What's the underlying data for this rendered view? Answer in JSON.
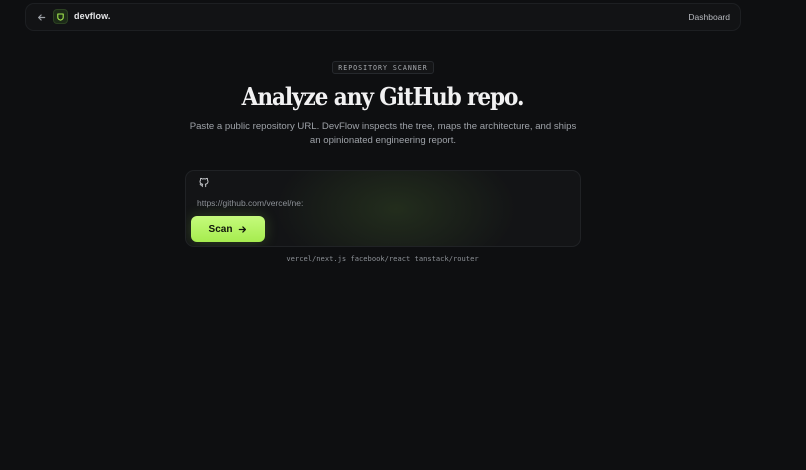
{
  "header": {
    "brand": "devflow.",
    "nav_link": "Dashboard"
  },
  "hero": {
    "kicker": "REPOSITORY SCANNER",
    "title": "Analyze any GitHub repo.",
    "subtitle": "Paste a public repository URL. DevFlow inspects the tree, maps the architecture, and ships an opinionated engineering report."
  },
  "scan": {
    "url_value": "",
    "url_placeholder": "https://github.com/vercel/ne:",
    "button_label": "Scan"
  },
  "suggestions": [
    "vercel/next.js",
    "facebook/react",
    "tanstack/router"
  ],
  "colors": {
    "background": "#0e0f11",
    "accent": "#b5f566",
    "accent_text": "#10140b"
  },
  "icons": {
    "back": "arrow-left-icon",
    "logo": "shield-icon",
    "repo": "github-icon",
    "scan": "arrow-right-icon"
  }
}
